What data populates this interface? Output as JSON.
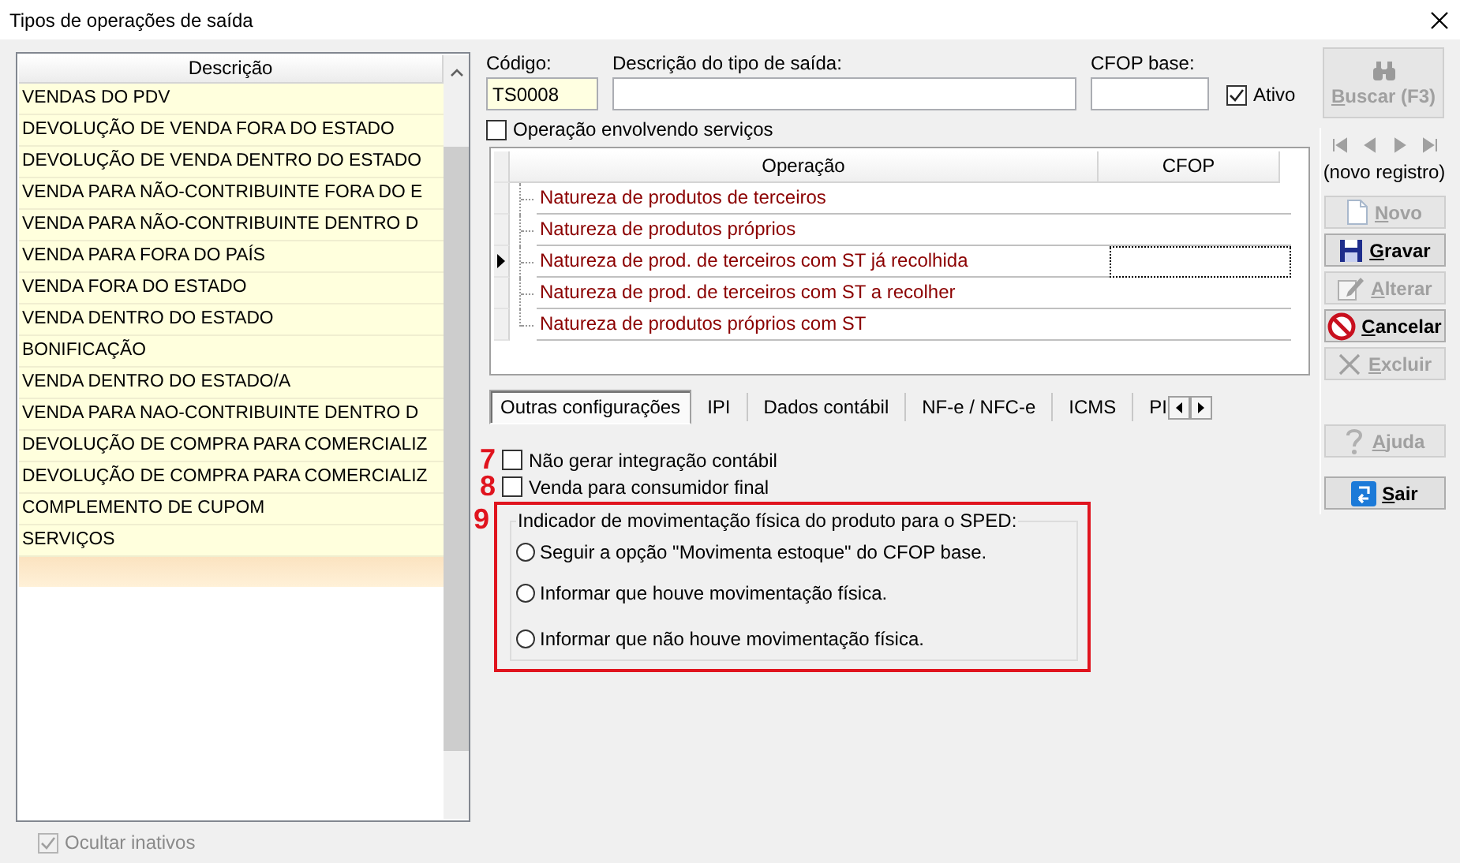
{
  "window": {
    "title": "Tipos de operações de saída"
  },
  "list": {
    "header": "Descrição",
    "new_row_selected": true,
    "rows": [
      {
        "text": "VENDAS DO PDV"
      },
      {
        "text": "DEVOLUÇÃO DE VENDA FORA DO ESTADO"
      },
      {
        "text": "DEVOLUÇÃO DE VENDA DENTRO DO ESTADO"
      },
      {
        "text": "VENDA PARA NÃO-CONTRIBUINTE FORA DO E"
      },
      {
        "text": "VENDA PARA NÃO-CONTRIBUINTE DENTRO D"
      },
      {
        "text": "VENDA PARA FORA DO PAÍS"
      },
      {
        "text": "VENDA FORA DO ESTADO"
      },
      {
        "text": "VENDA DENTRO DO ESTADO"
      },
      {
        "text": "BONIFICAÇÃO"
      },
      {
        "text": "VENDA DENTRO DO ESTADO/A"
      },
      {
        "text": "VENDA PARA NAO-CONTRIBUINTE DENTRO D"
      },
      {
        "text": "DEVOLUÇÃO DE COMPRA PARA COMERCIALIZ"
      },
      {
        "text": "DEVOLUÇÃO DE COMPRA PARA COMERCIALIZ"
      },
      {
        "text": "COMPLEMENTO DE CUPOM"
      },
      {
        "text": "SERVIÇOS"
      }
    ]
  },
  "hide_inactive": {
    "label": "Ocultar inativos",
    "checked": true,
    "disabled": true
  },
  "form": {
    "code": {
      "label": "Código:",
      "value": "TS0008"
    },
    "description": {
      "label": "Descrição do tipo de saída:"
    },
    "cfop_base": {
      "label": "CFOP base:"
    },
    "active": {
      "label": "Ativo",
      "checked": true
    },
    "services": {
      "label": "Operação envolvendo serviços",
      "checked": false
    }
  },
  "operations": {
    "columns": [
      "Operação",
      "CFOP"
    ],
    "rows": [
      {
        "text": "Natureza de produtos de terceiros",
        "selected": false
      },
      {
        "text": "Natureza de produtos próprios",
        "selected": false
      },
      {
        "text": "Natureza de prod. de terceiros com ST já recolhida",
        "selected": true
      },
      {
        "text": "Natureza de prod. de terceiros com ST a recolher",
        "selected": false
      },
      {
        "text": "Natureza de produtos próprios com ST",
        "selected": false
      }
    ]
  },
  "tabs": [
    {
      "label": "Outras configurações",
      "selected": true
    },
    {
      "label": "IPI",
      "selected": false
    },
    {
      "label": "Dados contábil",
      "selected": false
    },
    {
      "label": "NF-e / NFC-e",
      "selected": false
    },
    {
      "label": "ICMS",
      "selected": false
    },
    {
      "label": "PI",
      "selected": false
    }
  ],
  "options": [
    {
      "marker": "7",
      "label": "Não gerar integração contábil",
      "checked": false
    },
    {
      "marker": "8",
      "label": "Venda para consumidor final",
      "checked": false
    }
  ],
  "sped_group": {
    "marker": "9",
    "title": "Indicador de movimentação física do produto para o SPED:",
    "options": [
      {
        "label": "Seguir a opção \"Movimenta estoque\" do CFOP base.",
        "selected": false
      },
      {
        "label": "Informar que houve movimentação física.",
        "selected": false
      },
      {
        "label": "Informar que não houve movimentação física.",
        "selected": false
      }
    ]
  },
  "sidebar": {
    "search": {
      "label": "Buscar (F3)",
      "disabled": true
    },
    "record_status": "(novo registro)",
    "buttons": [
      {
        "kind": "new",
        "label": "Novo",
        "disabled": true
      },
      {
        "kind": "save",
        "label": "Gravar",
        "disabled": false
      },
      {
        "kind": "edit",
        "label": "Alterar",
        "disabled": true
      },
      {
        "kind": "cancel",
        "label": "Cancelar",
        "disabled": false
      },
      {
        "kind": "delete",
        "label": "Excluir",
        "disabled": true
      },
      {
        "kind": "help",
        "label": "Ajuda",
        "disabled": true
      },
      {
        "kind": "exit",
        "label": "Sair",
        "disabled": false
      }
    ]
  }
}
